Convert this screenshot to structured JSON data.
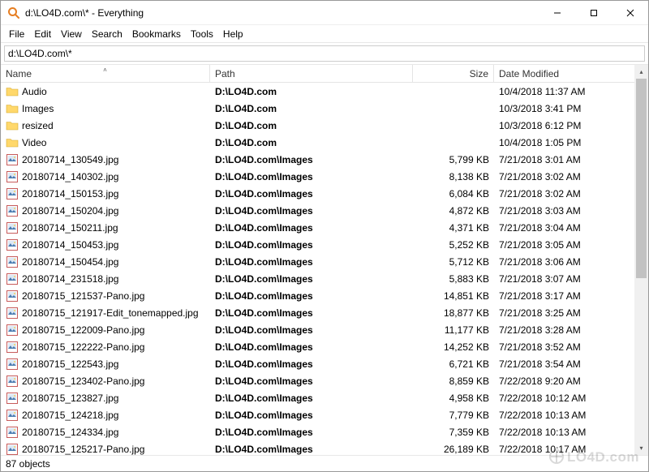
{
  "window": {
    "title": "d:\\LO4D.com\\* - Everything"
  },
  "menubar": {
    "items": [
      "File",
      "Edit",
      "View",
      "Search",
      "Bookmarks",
      "Tools",
      "Help"
    ]
  },
  "search": {
    "value": "d:\\LO4D.com\\*"
  },
  "columns": {
    "name": "Name",
    "path": "Path",
    "size": "Size",
    "date": "Date Modified"
  },
  "rows": [
    {
      "icon": "folder",
      "name": "Audio",
      "path": "D:\\LO4D.com",
      "size": "",
      "date": "10/4/2018 11:37 AM"
    },
    {
      "icon": "folder",
      "name": "Images",
      "path": "D:\\LO4D.com",
      "size": "",
      "date": "10/3/2018 3:41 PM"
    },
    {
      "icon": "folder",
      "name": "resized",
      "path": "D:\\LO4D.com",
      "size": "",
      "date": "10/3/2018 6:12 PM"
    },
    {
      "icon": "folder",
      "name": "Video",
      "path": "D:\\LO4D.com",
      "size": "",
      "date": "10/4/2018 1:05 PM"
    },
    {
      "icon": "image",
      "name": "20180714_130549.jpg",
      "path": "D:\\LO4D.com\\Images",
      "size": "5,799 KB",
      "date": "7/21/2018 3:01 AM"
    },
    {
      "icon": "image",
      "name": "20180714_140302.jpg",
      "path": "D:\\LO4D.com\\Images",
      "size": "8,138 KB",
      "date": "7/21/2018 3:02 AM"
    },
    {
      "icon": "image",
      "name": "20180714_150153.jpg",
      "path": "D:\\LO4D.com\\Images",
      "size": "6,084 KB",
      "date": "7/21/2018 3:02 AM"
    },
    {
      "icon": "image",
      "name": "20180714_150204.jpg",
      "path": "D:\\LO4D.com\\Images",
      "size": "4,872 KB",
      "date": "7/21/2018 3:03 AM"
    },
    {
      "icon": "image",
      "name": "20180714_150211.jpg",
      "path": "D:\\LO4D.com\\Images",
      "size": "4,371 KB",
      "date": "7/21/2018 3:04 AM"
    },
    {
      "icon": "image",
      "name": "20180714_150453.jpg",
      "path": "D:\\LO4D.com\\Images",
      "size": "5,252 KB",
      "date": "7/21/2018 3:05 AM"
    },
    {
      "icon": "image",
      "name": "20180714_150454.jpg",
      "path": "D:\\LO4D.com\\Images",
      "size": "5,712 KB",
      "date": "7/21/2018 3:06 AM"
    },
    {
      "icon": "image",
      "name": "20180714_231518.jpg",
      "path": "D:\\LO4D.com\\Images",
      "size": "5,883 KB",
      "date": "7/21/2018 3:07 AM"
    },
    {
      "icon": "image",
      "name": "20180715_121537-Pano.jpg",
      "path": "D:\\LO4D.com\\Images",
      "size": "14,851 KB",
      "date": "7/21/2018 3:17 AM"
    },
    {
      "icon": "image",
      "name": "20180715_121917-Edit_tonemapped.jpg",
      "path": "D:\\LO4D.com\\Images",
      "size": "18,877 KB",
      "date": "7/21/2018 3:25 AM"
    },
    {
      "icon": "image",
      "name": "20180715_122009-Pano.jpg",
      "path": "D:\\LO4D.com\\Images",
      "size": "11,177 KB",
      "date": "7/21/2018 3:28 AM"
    },
    {
      "icon": "image",
      "name": "20180715_122222-Pano.jpg",
      "path": "D:\\LO4D.com\\Images",
      "size": "14,252 KB",
      "date": "7/21/2018 3:52 AM"
    },
    {
      "icon": "image",
      "name": "20180715_122543.jpg",
      "path": "D:\\LO4D.com\\Images",
      "size": "6,721 KB",
      "date": "7/21/2018 3:54 AM"
    },
    {
      "icon": "image",
      "name": "20180715_123402-Pano.jpg",
      "path": "D:\\LO4D.com\\Images",
      "size": "8,859 KB",
      "date": "7/22/2018 9:20 AM"
    },
    {
      "icon": "image",
      "name": "20180715_123827.jpg",
      "path": "D:\\LO4D.com\\Images",
      "size": "4,958 KB",
      "date": "7/22/2018 10:12 AM"
    },
    {
      "icon": "image",
      "name": "20180715_124218.jpg",
      "path": "D:\\LO4D.com\\Images",
      "size": "7,779 KB",
      "date": "7/22/2018 10:13 AM"
    },
    {
      "icon": "image",
      "name": "20180715_124334.jpg",
      "path": "D:\\LO4D.com\\Images",
      "size": "7,359 KB",
      "date": "7/22/2018 10:13 AM"
    },
    {
      "icon": "image",
      "name": "20180715_125217-Pano.jpg",
      "path": "D:\\LO4D.com\\Images",
      "size": "26,189 KB",
      "date": "7/22/2018 10:17 AM"
    }
  ],
  "statusbar": {
    "text": "87 objects"
  },
  "watermark": "LO4D.com"
}
